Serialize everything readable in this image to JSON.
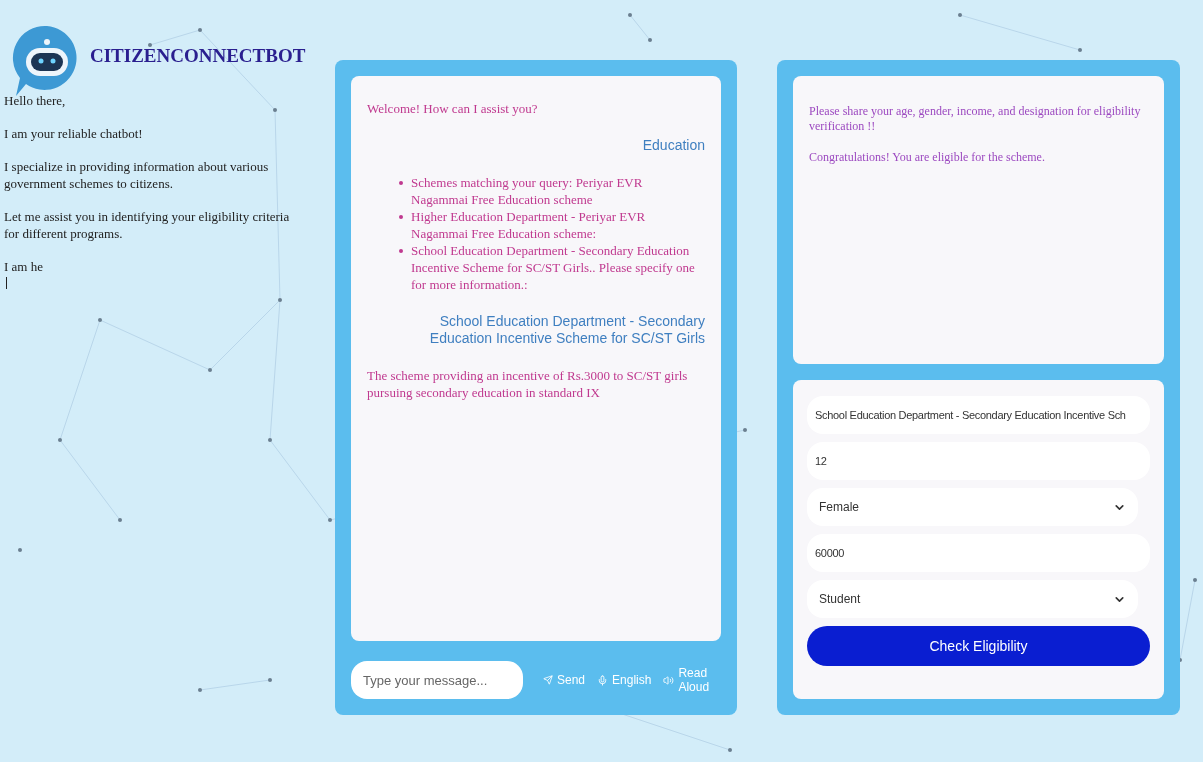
{
  "brand": {
    "title": "CITIZENCONNECTBOT"
  },
  "intro": [
    "Hello there,",
    "I am your reliable chatbot!",
    "I specialize in providing information about various government schemes to citizens.",
    "Let me assist you in identifying your eligibility criteria for different programs.",
    "I am he"
  ],
  "chat": {
    "messages": [
      {
        "kind": "bot",
        "text": "Welcome! How can I assist you?"
      },
      {
        "kind": "user",
        "text": "Education"
      },
      {
        "kind": "list",
        "items": [
          "Schemes matching your query: Periyar EVR Nagammai Free Education scheme",
          "Higher Education Department - Periyar EVR Nagammai Free Education scheme:",
          "School Education Department - Secondary Education Incentive Scheme for SC/ST Girls.. Please specify one for more information.:"
        ]
      },
      {
        "kind": "user",
        "text": "School Education Department - Secondary Education Incentive Scheme for SC/ST Girls"
      },
      {
        "kind": "bot",
        "text": "The scheme providing an incentive of Rs.3000 to SC/ST girls pursuing secondary education in standard IX"
      }
    ],
    "input": {
      "placeholder": "Type your message..."
    },
    "send": "Send",
    "language": "English",
    "read_aloud": "Read Aloud"
  },
  "eligibility": {
    "messages": [
      "Please share your age, gender, income, and designation for eligibility verification !!",
      "Congratulations! You are eligible for the scheme."
    ],
    "fields": [
      {
        "kind": "text",
        "value": "School Education Department - Secondary Education Incentive Sch"
      },
      {
        "kind": "text",
        "value": "12"
      },
      {
        "kind": "select",
        "value": "Female"
      },
      {
        "kind": "text",
        "value": "60000"
      },
      {
        "kind": "select",
        "value": "Student"
      }
    ],
    "button": "Check Eligibility"
  }
}
